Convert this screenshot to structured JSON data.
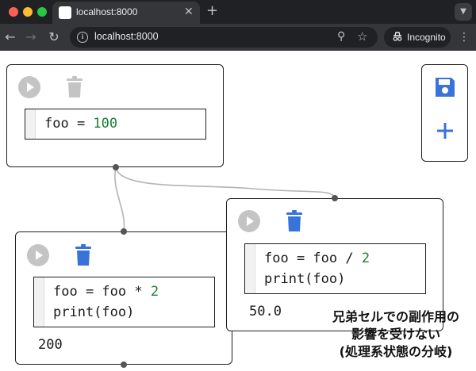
{
  "browser": {
    "tab_title": "localhost:8000",
    "url": "localhost:8000",
    "incognito_label": "Incognito",
    "icons": [
      "favicon",
      "close-icon",
      "plus-icon",
      "back-icon",
      "forward-icon",
      "reload-icon",
      "info-icon",
      "zoom-icon",
      "star-icon",
      "incognito-icon",
      "menu-icon"
    ]
  },
  "cells": [
    {
      "id": "cell-1",
      "code_lines": [
        [
          {
            "t": "foo = ",
            "k": "text"
          },
          {
            "t": "100",
            "k": "num"
          }
        ]
      ],
      "output": "",
      "delete_enabled": false
    },
    {
      "id": "cell-2",
      "code_lines": [
        [
          {
            "t": "foo = foo * ",
            "k": "text"
          },
          {
            "t": "2",
            "k": "num"
          }
        ],
        [
          {
            "t": "print(foo)",
            "k": "text"
          }
        ]
      ],
      "output": "200",
      "delete_enabled": true
    },
    {
      "id": "cell-3",
      "code_lines": [
        [
          {
            "t": "foo = foo / ",
            "k": "text"
          },
          {
            "t": "2",
            "k": "num"
          }
        ],
        [
          {
            "t": "print(foo)",
            "k": "text"
          }
        ]
      ],
      "output": "50.0",
      "delete_enabled": true
    }
  ],
  "side_panel": {
    "icons": [
      "save-icon",
      "add-icon"
    ]
  },
  "caption": {
    "line1": "兄弟セルでの副作用の",
    "line2": "影響を受けない",
    "line3": "(処理系状態の分岐)"
  },
  "colors": {
    "accent_blue": "#3874d8",
    "disabled_gray": "#c4c4c4",
    "number_green": "#1a7f37",
    "wire_gray": "#b4b4b4"
  }
}
